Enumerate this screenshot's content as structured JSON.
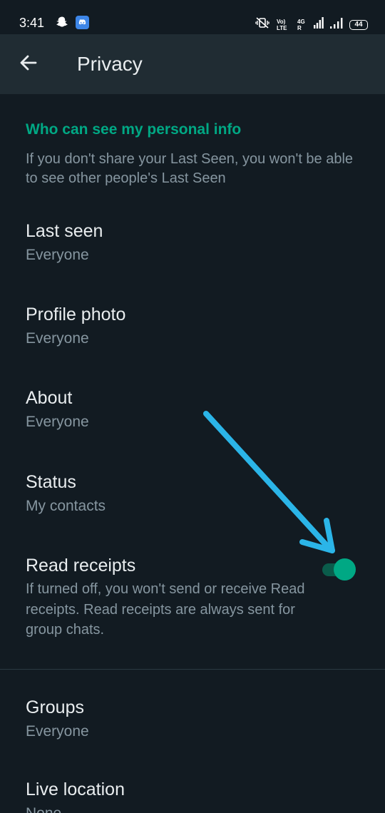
{
  "status_bar": {
    "time": "3:41",
    "icons_left": [
      "snapchat-icon",
      "discord-icon"
    ],
    "icons_right": [
      "mute-vibrate-icon",
      "volte-icon",
      "lte-4g-icon",
      "signal-icon-1",
      "signal-icon-2",
      "battery-icon"
    ],
    "volte_label": "Vo) LTE1",
    "lte_label": "4G R",
    "battery_level": "44"
  },
  "app_bar": {
    "back_icon": "arrow-left-icon",
    "title": "Privacy"
  },
  "section": {
    "header": "Who can see my personal info",
    "description": "If you don't share your Last Seen, you won't be able to see other people's Last Seen"
  },
  "items": [
    {
      "title": "Last seen",
      "value": "Everyone"
    },
    {
      "title": "Profile photo",
      "value": "Everyone"
    },
    {
      "title": "About",
      "value": "Everyone"
    },
    {
      "title": "Status",
      "value": "My contacts"
    }
  ],
  "read_receipts": {
    "title": "Read receipts",
    "description": "If turned off, you won't send or receive Read receipts. Read receipts are always sent for group chats.",
    "enabled": true
  },
  "items_after": [
    {
      "title": "Groups",
      "value": "Everyone"
    },
    {
      "title": "Live location",
      "value": "None"
    }
  ],
  "colors": {
    "background": "#121b22",
    "app_bar": "#202c33",
    "accent": "#00a884",
    "primary_text": "#e9edef",
    "secondary_text": "#8696a0",
    "annotation_arrow": "#2bb5e8"
  }
}
